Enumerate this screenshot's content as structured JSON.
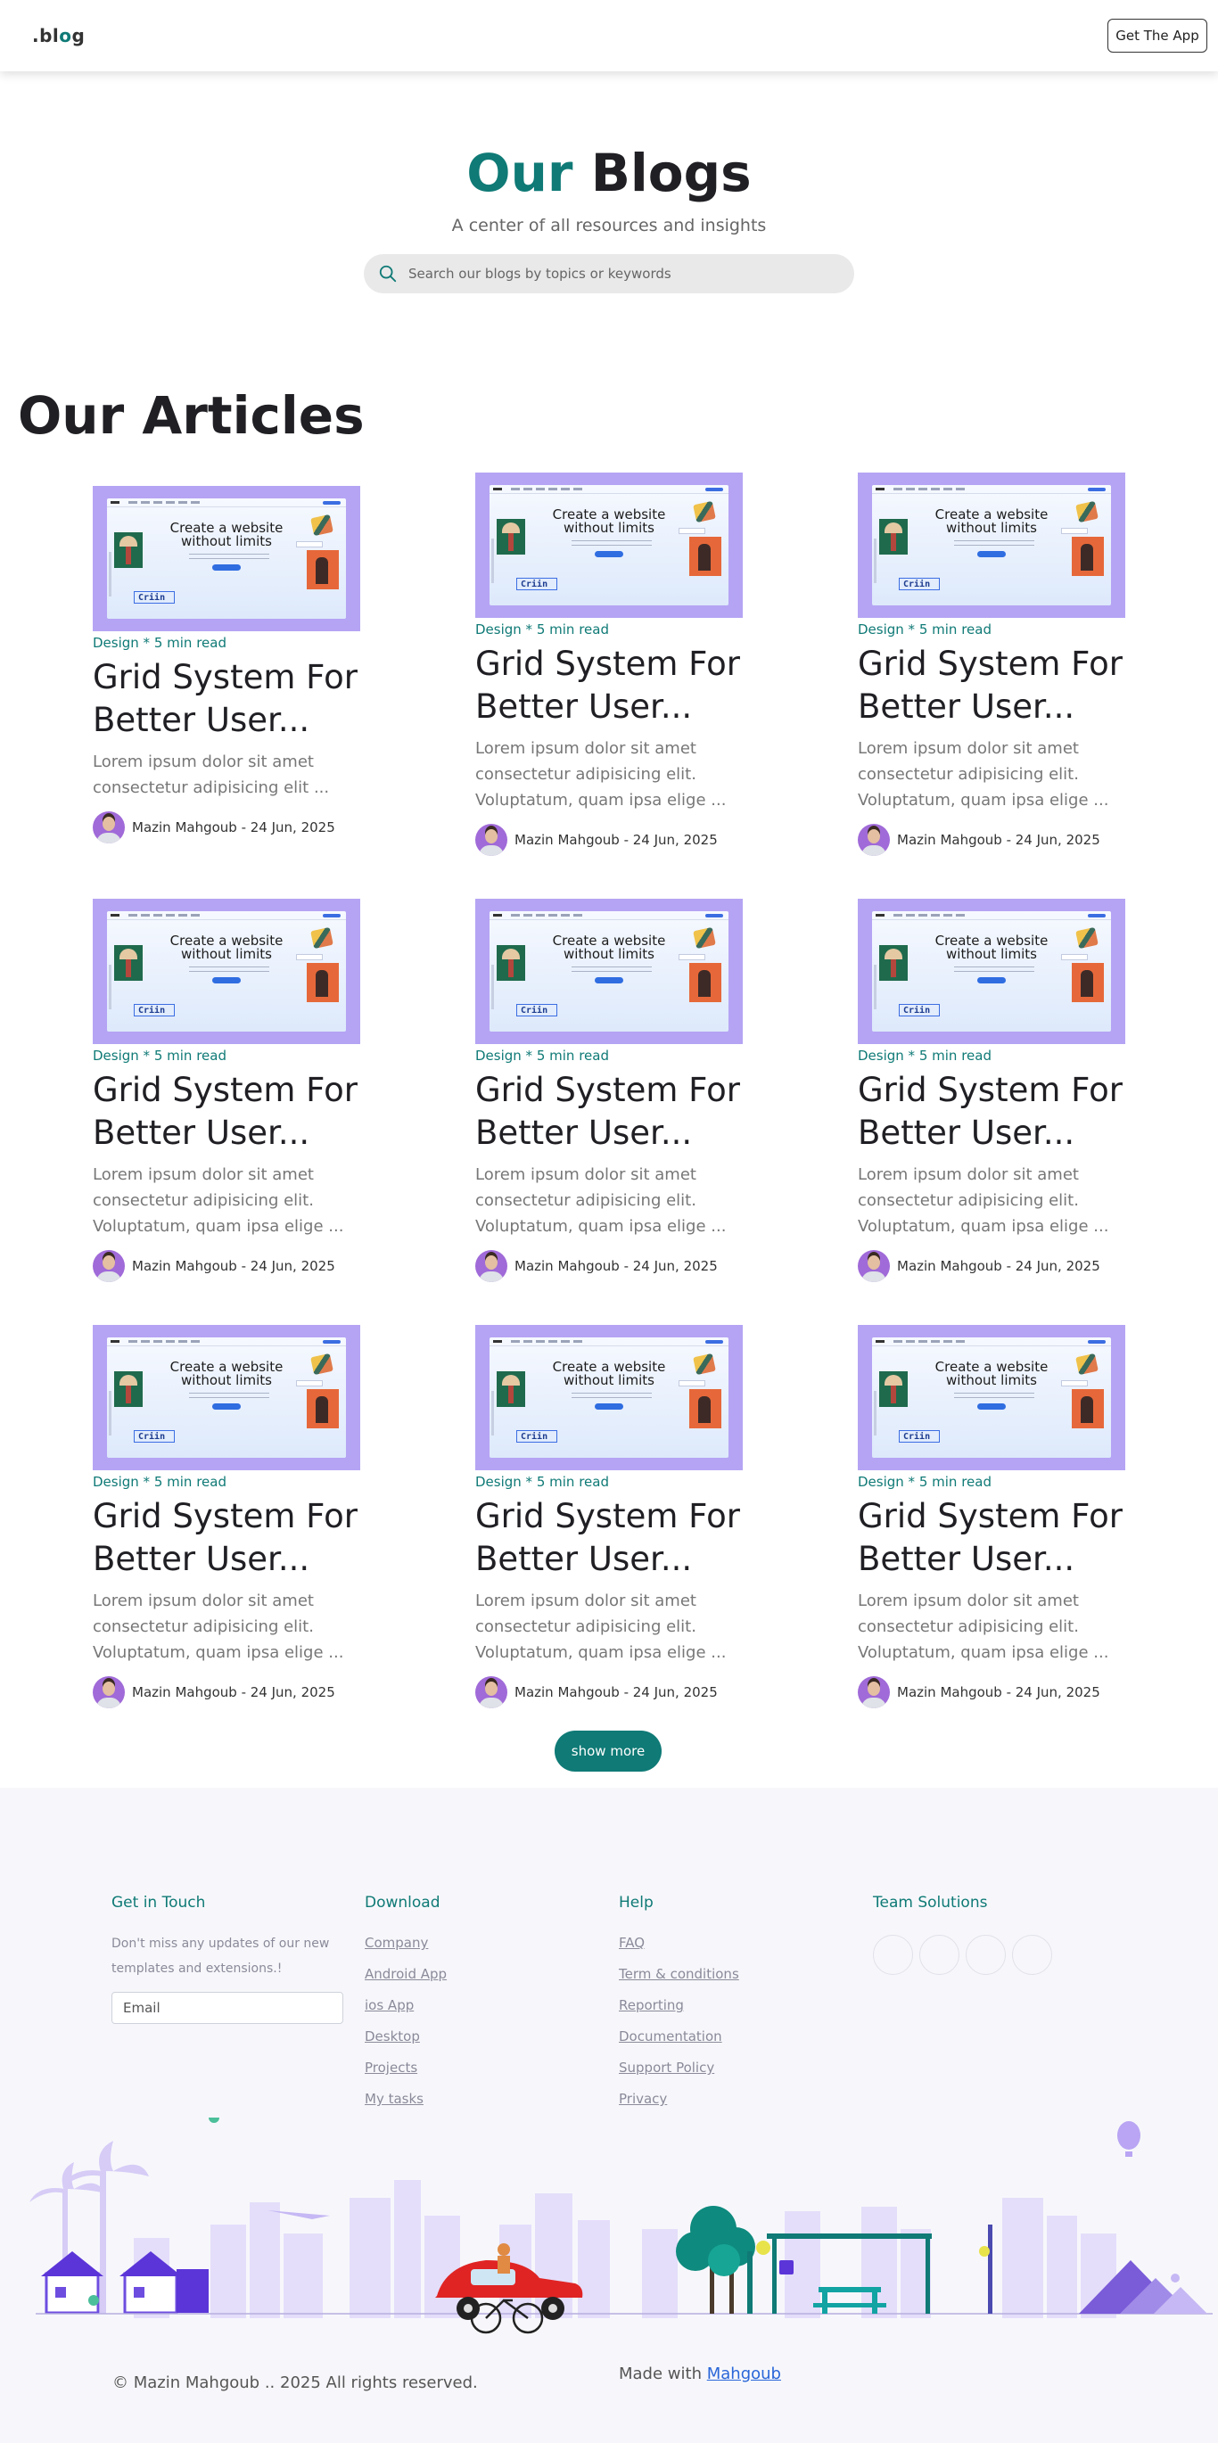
{
  "header": {
    "logo_prefix": ".bl",
    "logo_accent": "o",
    "logo_suffix": "g",
    "cta_label": "Get The App"
  },
  "hero": {
    "title_accent": "Our",
    "title_rest": "Blogs",
    "subtitle": "A center of all resources and insights",
    "search_placeholder": "Search our blogs by topics or keywords"
  },
  "articles_heading": "Our Articles",
  "thumbnail_headline": "Create a website without limits",
  "thumbnail_badge": "Criin",
  "cards": [
    {
      "category": "Design * 5 min read",
      "title": "Grid System For Better User...",
      "excerpt": "Lorem ipsum dolor sit amet consectetur adipisicing elit ...",
      "author": "Mazin Mahgoub - 24 Jun, 2025"
    },
    {
      "category": "Design * 5 min read",
      "title": "Grid System For Better User...",
      "excerpt": "Lorem ipsum dolor sit amet consectetur adipisicing elit. Voluptatum, quam ipsa elige ...",
      "author": "Mazin Mahgoub - 24 Jun, 2025"
    },
    {
      "category": "Design * 5 min read",
      "title": "Grid System For Better User...",
      "excerpt": "Lorem ipsum dolor sit amet consectetur adipisicing elit. Voluptatum, quam ipsa elige ...",
      "author": "Mazin Mahgoub - 24 Jun, 2025"
    },
    {
      "category": "Design * 5 min read",
      "title": "Grid System For Better User...",
      "excerpt": "Lorem ipsum dolor sit amet consectetur adipisicing elit. Voluptatum, quam ipsa elige ...",
      "author": "Mazin Mahgoub - 24 Jun, 2025"
    },
    {
      "category": "Design * 5 min read",
      "title": "Grid System For Better User...",
      "excerpt": "Lorem ipsum dolor sit amet consectetur adipisicing elit. Voluptatum, quam ipsa elige ...",
      "author": "Mazin Mahgoub - 24 Jun, 2025"
    },
    {
      "category": "Design * 5 min read",
      "title": "Grid System For Better User...",
      "excerpt": "Lorem ipsum dolor sit amet consectetur adipisicing elit. Voluptatum, quam ipsa elige ...",
      "author": "Mazin Mahgoub - 24 Jun, 2025"
    },
    {
      "category": "Design * 5 min read",
      "title": "Grid System For Better User...",
      "excerpt": "Lorem ipsum dolor sit amet consectetur adipisicing elit. Voluptatum, quam ipsa elige ...",
      "author": "Mazin Mahgoub - 24 Jun, 2025"
    },
    {
      "category": "Design * 5 min read",
      "title": "Grid System For Better User...",
      "excerpt": "Lorem ipsum dolor sit amet consectetur adipisicing elit. Voluptatum, quam ipsa elige ...",
      "author": "Mazin Mahgoub - 24 Jun, 2025"
    },
    {
      "category": "Design * 5 min read",
      "title": "Grid System For Better User...",
      "excerpt": "Lorem ipsum dolor sit amet consectetur adipisicing elit. Voluptatum, quam ipsa elige ...",
      "author": "Mazin Mahgoub - 24 Jun, 2025"
    }
  ],
  "show_more_label": "show more",
  "footer": {
    "get_in_touch": {
      "heading": "Get in Touch",
      "text": "Don't miss any updates of our new templates and extensions.!",
      "email_placeholder": "Email"
    },
    "download": {
      "heading": "Download",
      "links": [
        "Company",
        "Android App",
        "ios App",
        "Desktop",
        "Projects",
        "My tasks"
      ]
    },
    "help": {
      "heading": "Help",
      "links": [
        "FAQ",
        "Term & conditions",
        "Reporting",
        "Documentation",
        "Support Policy",
        "Privacy"
      ]
    },
    "team": {
      "heading": "Team Solutions"
    },
    "copyright": "© Mazin Mahgoub .. 2025 All rights reserved.",
    "made_with_prefix": "Made with",
    "made_with_link": "Mahgoub"
  },
  "colors": {
    "accent": "#0f7a76",
    "thumb_frame": "#b5a4f4",
    "link": "#2966d8"
  }
}
